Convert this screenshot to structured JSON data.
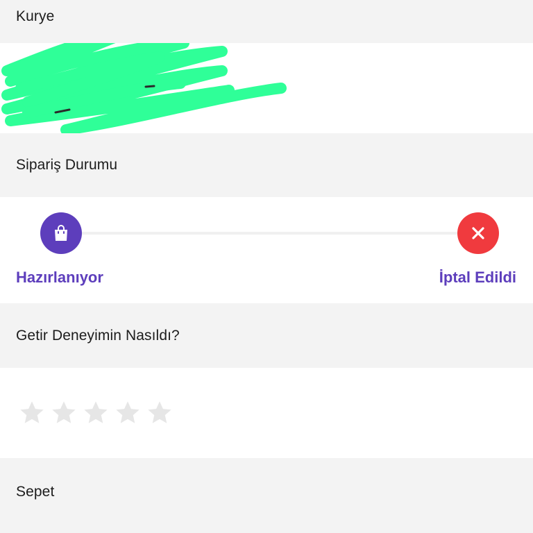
{
  "courier": {
    "header": "Kurye",
    "name_redacted": true,
    "redaction_color": "#2fff98"
  },
  "order_status": {
    "header": "Sipariş Durumu",
    "steps": [
      {
        "label": "Hazırlanıyor",
        "icon": "shopping-bag-icon",
        "color": "#5d3ebc"
      },
      {
        "label": "İptal Edildi",
        "icon": "close-icon",
        "color": "#f03a3e"
      }
    ],
    "label_color": "#5d3ebc"
  },
  "rating": {
    "header": "Getir Deneyimin Nasıldı?",
    "max_stars": 5,
    "selected": 0,
    "star_color": "#e6e6e6"
  },
  "basket": {
    "header": "Sepet"
  }
}
